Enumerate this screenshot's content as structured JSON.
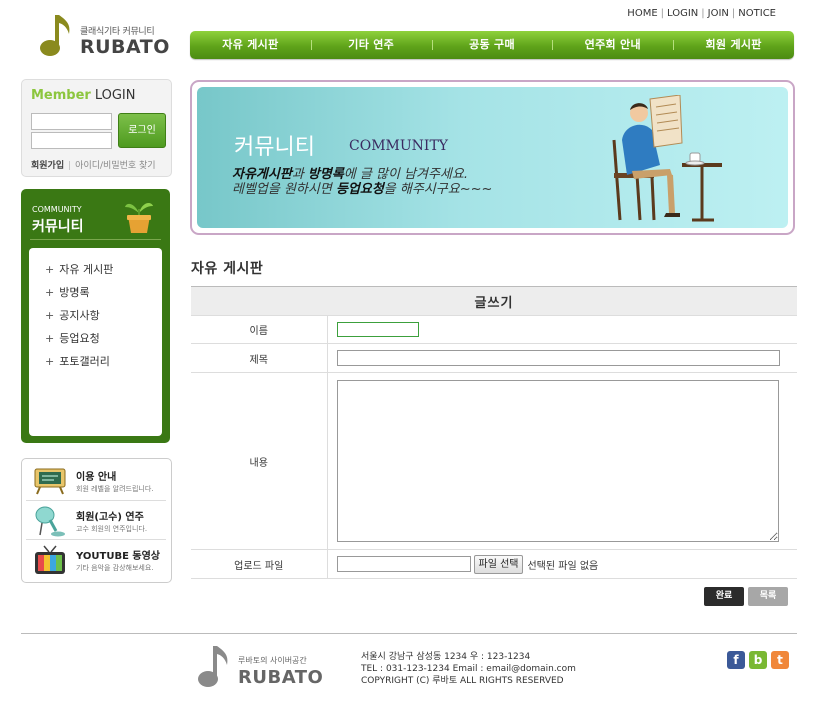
{
  "header": {
    "logo_tagline": "클래식기타 커뮤니티",
    "logo_name": "RUBATO",
    "top_links": [
      "HOME",
      "LOGIN",
      "JOIN",
      "NOTICE"
    ],
    "nav": [
      "자유 게시판",
      "기타 연주",
      "공동 구매",
      "연주회 안내",
      "회원 게시판"
    ]
  },
  "login": {
    "title_member": "Member",
    "title_login": "LOGIN",
    "button": "로그인",
    "join": "회원가입",
    "find": "아이디/비밀번호 찾기"
  },
  "community": {
    "title_en": "COMMUNITY",
    "title_ko": "커뮤니티",
    "items": [
      "자유 게시판",
      "방명록",
      "공지사항",
      "등업요청",
      "포토갤러리"
    ]
  },
  "info": [
    {
      "title": "이용 안내",
      "sub": "회원 레벨을 알려드립니다.",
      "icon": "board-icon"
    },
    {
      "title": "회원(고수) 연주",
      "sub": "고수 회원의 연주입니다.",
      "icon": "microphone-icon"
    },
    {
      "title": "YOUTUBE 동영상",
      "sub": "기타 음악을 감상해보세요.",
      "icon": "tv-icon"
    }
  ],
  "banner": {
    "title_ko": "커뮤니티",
    "title_en": "COMMUNITY",
    "line1_b1": "자유게시판",
    "line1_t1": "과 ",
    "line1_b2": "방명록",
    "line1_t2": "에 글 많이 남겨주세요.",
    "line2_t1": "레벨업을 원하시면 ",
    "line2_b1": "등업요청",
    "line2_t2": "을 해주시구요~~~"
  },
  "board": {
    "title": "자유 게시판",
    "form_heading": "글쓰기",
    "label_name": "이름",
    "label_subject": "제목",
    "label_content": "내용",
    "label_file": "업로드 파일",
    "file_button": "파일 선택",
    "file_none": "선택된 파일 없음",
    "submit": "완료",
    "list": "목록"
  },
  "footer": {
    "tagline": "루바토의 사이버공간",
    "name": "RUBATO",
    "address": "서울시 강남구 삼성동 1234 우 : 123-1234",
    "contact": "TEL : 031-123-1234 Email : email@domain.com",
    "copyright": "COPYRIGHT (C) 루바토 ALL RIGHTS RESERVED",
    "sns": [
      "f",
      "b",
      "t"
    ]
  },
  "colors": {
    "accent_green": "#5fa31a",
    "sidebar_green": "#3a7814",
    "banner_teal": "#a5e3e6"
  }
}
